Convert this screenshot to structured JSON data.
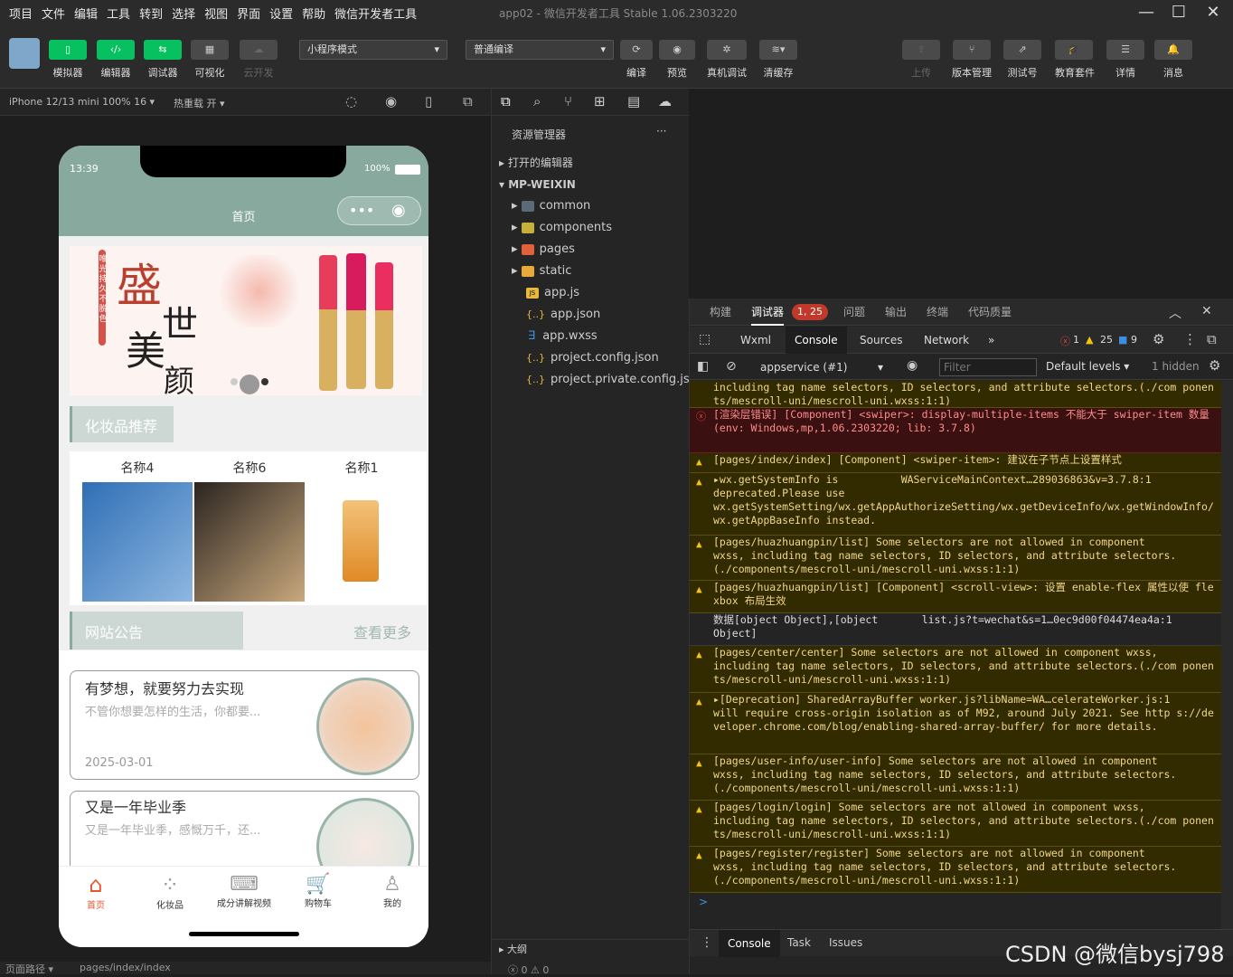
{
  "menu": [
    "项目",
    "文件",
    "编辑",
    "工具",
    "转到",
    "选择",
    "视图",
    "界面",
    "设置",
    "帮助",
    "微信开发者工具"
  ],
  "window_title": "app02 - 微信开发者工具 Stable 1.06.2303220",
  "toolbar": {
    "left_labels": [
      "模拟器",
      "编辑器",
      "调试器",
      "可视化",
      "云开发"
    ],
    "mode_select": "小程序模式",
    "compile_select": "普通编译",
    "mid_labels": [
      "编译",
      "预览",
      "真机调试",
      "清缓存"
    ],
    "right_labels": [
      "上传",
      "版本管理",
      "测试号",
      "教育套件",
      "详情",
      "消息"
    ]
  },
  "simbar": {
    "device": "iPhone 12/13 mini 100% 16 ▾",
    "hotreload": "热重载 开 ▾"
  },
  "phone": {
    "time": "13:39",
    "battery": "100%",
    "nav_title": "首页",
    "banner_title_1": "盛",
    "banner_title_2": "世",
    "banner_title_3": "美",
    "banner_title_4": "颜",
    "banner_vertical": "唯光持久不脱色",
    "section1": "化妆品推荐",
    "products": [
      "名称4",
      "名称6",
      "名称1"
    ],
    "section2": "网站公告",
    "more": "查看更多",
    "news": [
      {
        "title": "有梦想，就要努力去实现",
        "desc": "不管你想要怎样的生活，你都要...",
        "date": "2025-03-01"
      },
      {
        "title": "又是一年毕业季",
        "desc": "又是一年毕业季，感慨万千，还...",
        "date": ""
      }
    ],
    "tabs": [
      "首页",
      "化妆品",
      "成分讲解视频",
      "购物车",
      "我的"
    ]
  },
  "explorer": {
    "title": "资源管理器",
    "more": "···",
    "open_editors": "打开的编辑器",
    "project": "MP-WEIXIN",
    "folders": [
      "common",
      "components",
      "pages",
      "static"
    ],
    "files": [
      {
        "name": "app.js",
        "icon": "JS"
      },
      {
        "name": "app.json",
        "icon": "{..}"
      },
      {
        "name": "app.wxss",
        "icon": "∃"
      },
      {
        "name": "project.config.json",
        "icon": "{..}"
      },
      {
        "name": "project.private.config.js...",
        "icon": "{..}"
      }
    ],
    "outline": "大纲",
    "status": "ⓧ 0 ⚠ 0"
  },
  "devtools": {
    "top_tabs": [
      "构建",
      "调试器",
      "问题",
      "输出",
      "终端",
      "代码质量"
    ],
    "badge": "1, 25",
    "panel_tabs": [
      "Wxml",
      "Console",
      "Sources",
      "Network"
    ],
    "counts": {
      "err": "1",
      "warn": "25",
      "info": "9"
    },
    "context": "appservice (#1)",
    "filter_placeholder": "Filter",
    "levels": "Default levels ▾",
    "hidden": "1 hidden",
    "logs": [
      {
        "type": "warn",
        "text": "including tag name selectors, ID selectors, and attribute selectors.(./com ponents/mescroll-uni/mescroll-uni.wxss:1:1)"
      },
      {
        "type": "err",
        "text": "[渲染层错误] [Component] <swiper>: display-multiple-items 不能大于 swiper-item 数量\n(env: Windows,mp,1.06.2303220; lib: 3.7.8)"
      },
      {
        "type": "warn",
        "text": "[pages/index/index] [Component] <swiper-item>: 建议在子节点上设置样式"
      },
      {
        "type": "warn",
        "text": "▸wx.getSystemInfo is          WAServiceMainContext…289036863&v=3.7.8:1\ndeprecated.Please use\nwx.getSystemSetting/wx.getAppAuthorizeSetting/wx.getDeviceInfo/wx.getWindowInfo/wx.getAppBaseInfo instead."
      },
      {
        "type": "warn",
        "text": "[pages/huazhuangpin/list] Some selectors are not allowed in component\nwxss, including tag name selectors, ID selectors, and attribute selectors.\n(./components/mescroll-uni/mescroll-uni.wxss:1:1)"
      },
      {
        "type": "warn",
        "text": "[pages/huazhuangpin/list] [Component] <scroll-view>: 设置 enable-flex 属性以使 flexbox 布局生效"
      },
      {
        "type": "info",
        "text": "数据[object Object],[object       list.js?t=wechat&s=1…0ec9d00f04474ea4a:1\nObject]"
      },
      {
        "type": "warn",
        "text": "[pages/center/center] Some selectors are not allowed in component wxss,\nincluding tag name selectors, ID selectors, and attribute selectors.(./com ponents/mescroll-uni/mescroll-uni.wxss:1:1)"
      },
      {
        "type": "warn",
        "text": "▸[Deprecation] SharedArrayBuffer worker.js?libName=WA…celerateWorker.js:1\nwill require cross-origin isolation as of M92, around July 2021. See http s://developer.chrome.com/blog/enabling-shared-array-buffer/ for more details."
      },
      {
        "type": "warn",
        "text": "[pages/user-info/user-info] Some selectors are not allowed in component\nwxss, including tag name selectors, ID selectors, and attribute selectors.\n(./components/mescroll-uni/mescroll-uni.wxss:1:1)"
      },
      {
        "type": "warn",
        "text": "[pages/login/login] Some selectors are not allowed in component wxss,\nincluding tag name selectors, ID selectors, and attribute selectors.(./com ponents/mescroll-uni/mescroll-uni.wxss:1:1)"
      },
      {
        "type": "warn",
        "text": "[pages/register/register] Some selectors are not allowed in component\nwxss, including tag name selectors, ID selectors, and attribute selectors.\n(./components/mescroll-uni/mescroll-uni.wxss:1:1)"
      }
    ],
    "prompt": ">",
    "bottom_tabs": [
      "Console",
      "Task",
      "Issues"
    ]
  },
  "statusbar": {
    "path_label": "页面路径 ▾",
    "path": "pages/index/index"
  },
  "watermark": "CSDN @微信bysj798",
  "colors": {
    "accent": "#07c160",
    "phone_header": "#88aa9e",
    "section_bg": "#cdd8d4"
  }
}
